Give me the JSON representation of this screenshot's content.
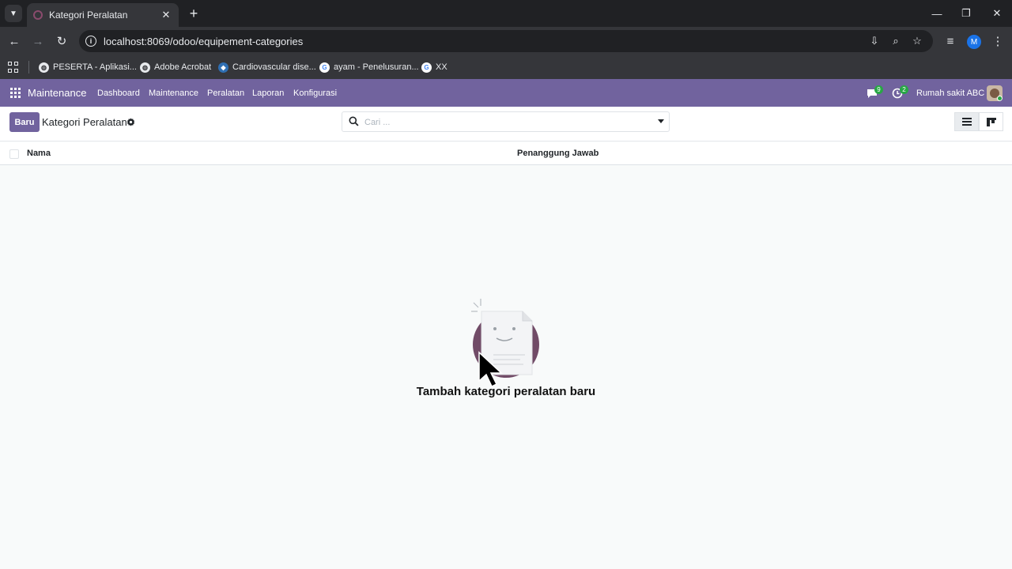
{
  "browser": {
    "tab_title": "Kategori Peralatan",
    "url": "localhost:8069/odoo/equipement-categories",
    "profile_initial": "M",
    "bookmarks": [
      {
        "label": "PESERTA - Aplikasi...",
        "icon": "globe-icon"
      },
      {
        "label": "Adobe Acrobat",
        "icon": "globe-icon"
      },
      {
        "label": "Cardiovascular dise...",
        "icon": "site-icon"
      },
      {
        "label": "ayam - Penelusuran...",
        "icon": "google-icon"
      },
      {
        "label": "XX",
        "icon": "google-icon"
      }
    ]
  },
  "navbar": {
    "app_name": "Maintenance",
    "menu": [
      "Dashboard",
      "Maintenance",
      "Peralatan",
      "Laporan",
      "Konfigurasi"
    ],
    "messages_badge": "9",
    "activities_badge": "2",
    "company": "Rumah sakit ABC",
    "accent_color": "#71639e"
  },
  "control_panel": {
    "new_button": "Baru",
    "breadcrumb": "Kategori Peralatan",
    "search_placeholder": "Cari ..."
  },
  "list": {
    "columns": [
      "Nama",
      "Penanggung Jawab"
    ]
  },
  "empty_state": {
    "title": "Tambah kategori peralatan baru"
  }
}
